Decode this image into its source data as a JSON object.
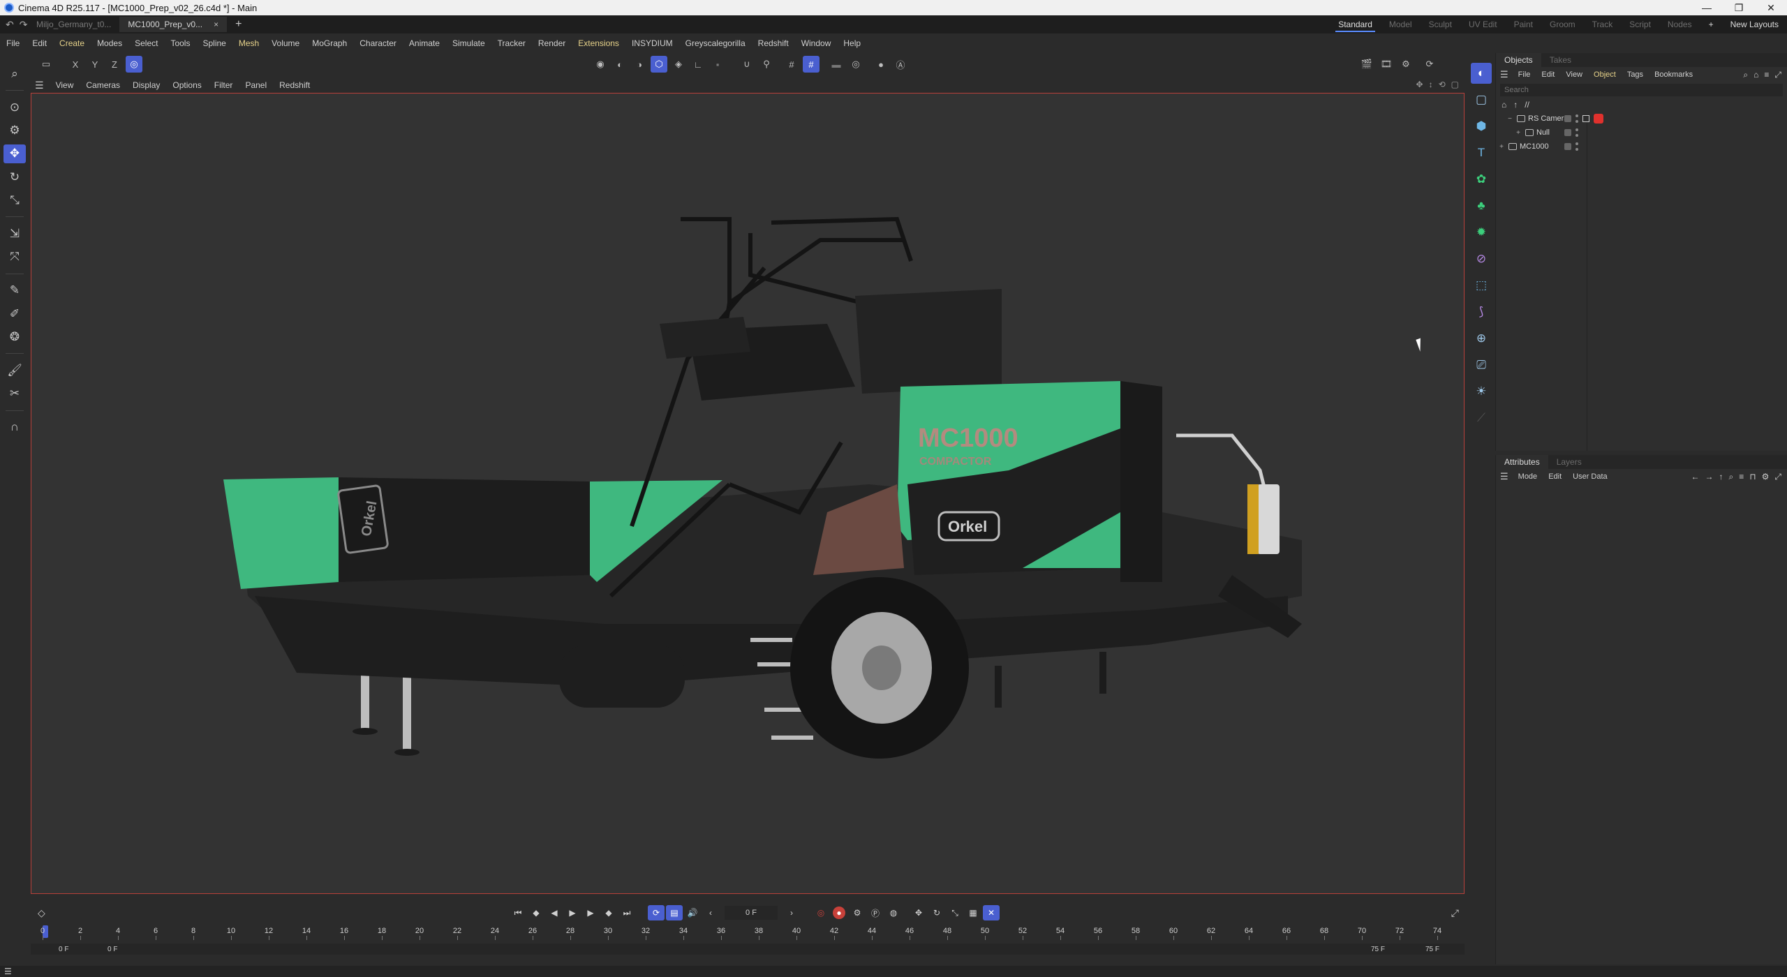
{
  "window": {
    "title": "Cinema 4D R25.117 - [MC1000_Prep_v02_26.c4d *] - Main",
    "minimize": "—",
    "maximize": "❐",
    "close": "✕"
  },
  "tabs": {
    "items": [
      {
        "label": "Miljo_Germany_t0..."
      },
      {
        "label": "MC1000_Prep_v0..."
      }
    ],
    "close_glyph": "×",
    "add_glyph": "+"
  },
  "layouts": {
    "items": [
      "Standard",
      "Model",
      "Sculpt",
      "UV Edit",
      "Paint",
      "Groom",
      "Track",
      "Script",
      "Nodes"
    ],
    "add_glyph": "+",
    "new_layouts": "New Layouts"
  },
  "menu": [
    "File",
    "Edit",
    "Create",
    "Modes",
    "Select",
    "Tools",
    "Spline",
    "Mesh",
    "Volume",
    "MoGraph",
    "Character",
    "Animate",
    "Simulate",
    "Tracker",
    "Render",
    "Extensions",
    "INSYDIUM",
    "Greyscalegorilla",
    "Redshift",
    "Window",
    "Help"
  ],
  "toolbar": {
    "axes": [
      "X",
      "Y",
      "Z"
    ]
  },
  "viewport": {
    "menu": [
      "View",
      "Cameras",
      "Display",
      "Options",
      "Filter",
      "Panel",
      "Redshift"
    ],
    "model_logo_text": "MC1000",
    "model_sub_text": "COMPACTOR",
    "brand_text": "Orkel",
    "brand_text_2": "Orkel",
    "colors": {
      "body_green": "#3fb87f",
      "frame_dark": "#232323",
      "border": "#b8403a"
    }
  },
  "objects_panel": {
    "tabs": [
      "Objects",
      "Takes"
    ],
    "menu": [
      "File",
      "Edit",
      "View",
      "Object",
      "Tags",
      "Bookmarks"
    ],
    "search_placeholder": "Search",
    "path": "//",
    "items": [
      {
        "name": "RS Camera",
        "expand": "−"
      },
      {
        "name": "Null",
        "expand": "+"
      },
      {
        "name": "MC1000",
        "expand": "+"
      }
    ]
  },
  "attributes_panel": {
    "tabs": [
      "Attributes",
      "Layers"
    ],
    "menu": [
      "Mode",
      "Edit",
      "User Data"
    ]
  },
  "timeline": {
    "current_frame": "0 F",
    "ticks": [
      0,
      2,
      4,
      6,
      8,
      10,
      12,
      14,
      16,
      18,
      20,
      22,
      24,
      26,
      28,
      30,
      32,
      34,
      36,
      38,
      40,
      42,
      44,
      46,
      48,
      50,
      52,
      54,
      56,
      58,
      60,
      62,
      64,
      66,
      68,
      70,
      72,
      74
    ],
    "range_start": "0 F",
    "range_start_2": "0 F",
    "range_end": "75 F",
    "range_end_2": "75 F"
  }
}
